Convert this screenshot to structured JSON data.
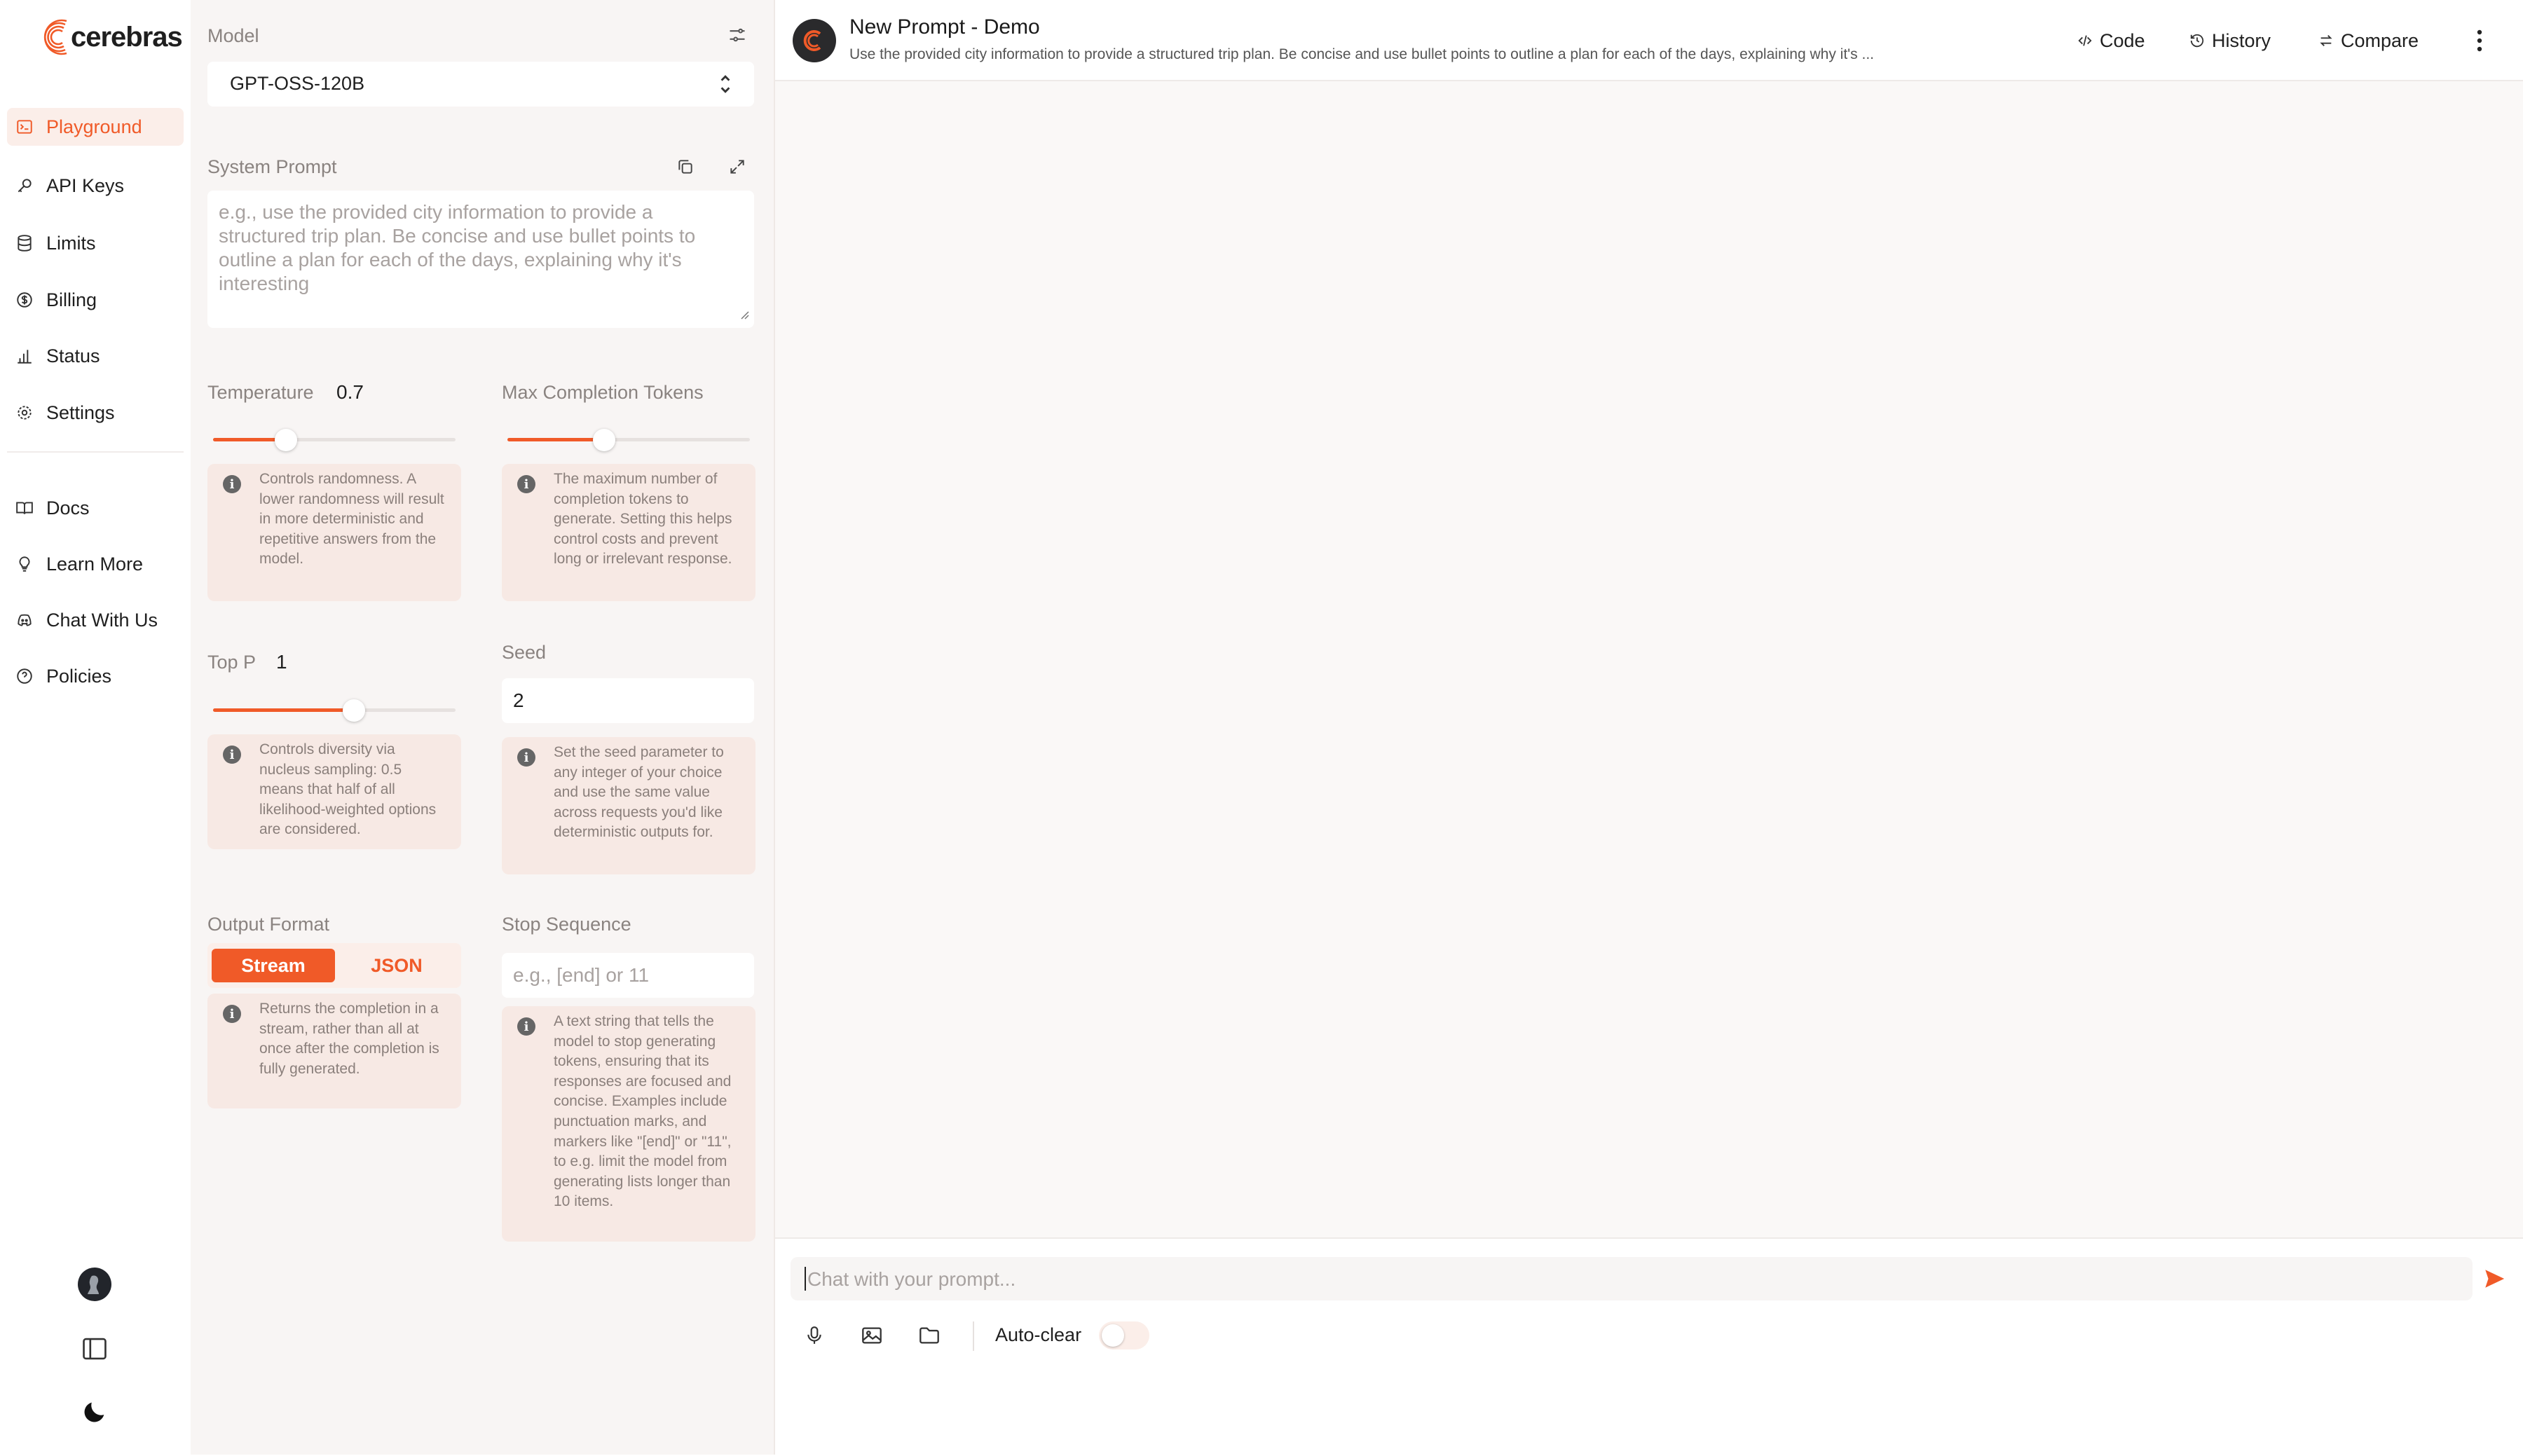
{
  "brand": {
    "name": "cerebras",
    "accent": "#f05a28"
  },
  "nav": {
    "items": [
      {
        "label": "Playground",
        "icon": "terminal-icon",
        "active": true
      },
      {
        "label": "API Keys",
        "icon": "key-icon"
      },
      {
        "label": "Limits",
        "icon": "database-icon"
      },
      {
        "label": "Billing",
        "icon": "dollar-icon"
      },
      {
        "label": "Status",
        "icon": "bar-chart-icon"
      },
      {
        "label": "Settings",
        "icon": "gear-icon"
      },
      {
        "label": "Docs",
        "icon": "book-icon"
      },
      {
        "label": "Learn More",
        "icon": "lightbulb-icon"
      },
      {
        "label": "Chat With Us",
        "icon": "discord-icon"
      },
      {
        "label": "Policies",
        "icon": "help-circle-icon"
      }
    ]
  },
  "panel": {
    "model": {
      "label": "Model",
      "value": "GPT-OSS-120B"
    },
    "system_prompt": {
      "label": "System Prompt",
      "placeholder": "e.g., use the provided city information to provide a structured trip plan. Be concise and use bullet points to outline a plan for each of the days, explaining why it's interesting"
    },
    "temperature": {
      "label": "Temperature",
      "value": "0.7",
      "slider_fraction": 0.3,
      "info": "Controls randomness. A lower randomness will result in more deterministic and repetitive answers from the model."
    },
    "max_tokens": {
      "label": "Max Completion Tokens",
      "slider_fraction": 0.4,
      "info": "The maximum number of completion tokens to generate. Setting this helps control costs and prevent long or irrelevant response."
    },
    "top_p": {
      "label": "Top P",
      "value": "1",
      "slider_fraction": 0.58,
      "info": "Controls diversity via nucleus sampling: 0.5 means that half of all likelihood-weighted options are considered."
    },
    "seed": {
      "label": "Seed",
      "value": "2",
      "info": "Set the seed parameter to any integer of your choice and use the same value across requests you'd like deterministic outputs for."
    },
    "output_format": {
      "label": "Output Format",
      "options": [
        "Stream",
        "JSON"
      ],
      "selected": "Stream",
      "info": "Returns the completion in a stream, rather than all at once after the completion is fully generated."
    },
    "stop_sequence": {
      "label": "Stop Sequence",
      "placeholder": "e.g., [end] or 11",
      "info": "A text string that tells the model to stop generating tokens, ensuring that its responses are focused and concise. Examples include punctuation marks, and markers like \"[end]\" or \"11\", to e.g. limit the model from generating lists longer than 10 items."
    }
  },
  "header": {
    "title": "New Prompt - Demo",
    "subtitle": "Use the provided city information to provide a structured trip plan. Be concise and use bullet points to outline a plan for each of the days, explaining why it's ...",
    "code_label": "Code",
    "history_label": "History",
    "compare_label": "Compare"
  },
  "composer": {
    "placeholder": "Chat with your prompt...",
    "auto_clear_label": "Auto-clear",
    "auto_clear_on": false
  }
}
